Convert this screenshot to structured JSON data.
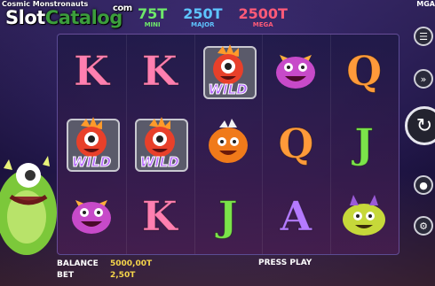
{
  "header": {
    "game_title": "Cosmic Monstronauts",
    "right_title": "MGA",
    "watermark_part1": "Slot",
    "watermark_part2": "Catalog",
    "watermark_suffix": "com"
  },
  "jackpots": [
    {
      "amount": "75T",
      "label": "MINI",
      "color": "#6ee86a"
    },
    {
      "amount": "250T",
      "label": "MAJOR",
      "color": "#5ec4ff"
    },
    {
      "amount": "2500T",
      "label": "MEGA",
      "color": "#ff5a78"
    }
  ],
  "reels": [
    [
      {
        "type": "letter",
        "value": "K",
        "color": "#ff7fb0"
      },
      {
        "type": "wild",
        "value": "WILD",
        "icon": "red-cyclops-monster-icon"
      },
      {
        "type": "monster",
        "icon": "purple-horned-monster-icon"
      }
    ],
    [
      {
        "type": "letter",
        "value": "K",
        "color": "#ff7fb0"
      },
      {
        "type": "wild",
        "value": "WILD",
        "icon": "red-cyclops-monster-icon"
      },
      {
        "type": "letter",
        "value": "K",
        "color": "#ff7fb0"
      }
    ],
    [
      {
        "type": "wild",
        "value": "WILD",
        "icon": "red-cyclops-monster-icon"
      },
      {
        "type": "monster",
        "icon": "orange-fluffy-monster-icon"
      },
      {
        "type": "letter",
        "value": "J",
        "color": "#7be34a"
      }
    ],
    [
      {
        "type": "monster",
        "icon": "purple-horned-monster-icon"
      },
      {
        "type": "letter",
        "value": "Q",
        "color": "#ff9a3a"
      },
      {
        "type": "letter",
        "value": "A",
        "color": "#b57aff"
      }
    ],
    [
      {
        "type": "letter",
        "value": "Q",
        "color": "#ff9a3a"
      },
      {
        "type": "letter",
        "value": "J",
        "color": "#7be34a"
      },
      {
        "type": "monster",
        "icon": "yellow-green-monster-icon"
      }
    ]
  ],
  "footer": {
    "balance_label": "BALANCE",
    "balance_value": "5000,00T",
    "bet_label": "BET",
    "bet_value": "2,50T",
    "press_play": "PRESS PLAY"
  },
  "side_buttons": [
    {
      "icon": "menu-icon"
    },
    {
      "icon": "autoplay-icon"
    },
    {
      "icon": "spin-icon"
    },
    {
      "icon": "coins-icon"
    },
    {
      "icon": "settings-icon"
    }
  ]
}
